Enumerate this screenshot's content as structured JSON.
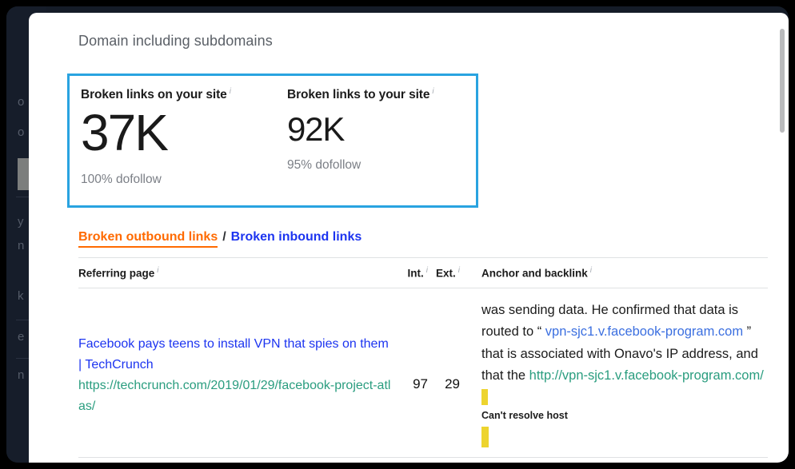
{
  "app": {
    "sidebar_ghost_lines": [
      "o",
      "o",
      "y",
      "n",
      "k",
      "e",
      "n"
    ]
  },
  "header": {
    "title": "Domain including subdomains"
  },
  "metrics": {
    "border_color": "#29a3e0",
    "items": [
      {
        "label": "Broken links on your site",
        "info_icon": "info-icon",
        "value": "37K",
        "sub": "100% dofollow"
      },
      {
        "label": "Broken links to your site",
        "info_icon": "info-icon",
        "value": "92K",
        "sub": "95% dofollow"
      }
    ]
  },
  "tabs": {
    "active_label": "Broken outbound links",
    "separator": "/",
    "inactive_label": "Broken inbound links",
    "active_color": "#ff6a00",
    "inactive_color": "#1c34f0"
  },
  "table": {
    "columns": [
      {
        "key": "referring_page",
        "label": "Referring page",
        "info": true
      },
      {
        "key": "int",
        "label": "Int.",
        "info": true
      },
      {
        "key": "ext",
        "label": "Ext.",
        "info": true
      },
      {
        "key": "anchor",
        "label": "Anchor and backlink",
        "info": true
      }
    ],
    "rows": [
      {
        "referring_page_title": "Facebook pays teens to install VPN that spies on them | TechCrunch",
        "referring_page_url": "https://techcrunch.com/2019/01/29/facebook-project-atlas/",
        "int": "97",
        "ext": "29",
        "anchor_text_1": "was sending data. He confirmed that data is routed to “ ",
        "anchor_link": "vpn-sjc1.v.facebook-program.com",
        "anchor_text_2": " ” that is associated with Onavo's IP address, and that the ",
        "backlink_url": "http://vpn-sjc1.v.facebook-program.com/",
        "error_note": "Can't resolve host",
        "highlight_color": "#edd42e"
      }
    ]
  },
  "scrollbar": {
    "thumb_color": "#b9babc"
  }
}
